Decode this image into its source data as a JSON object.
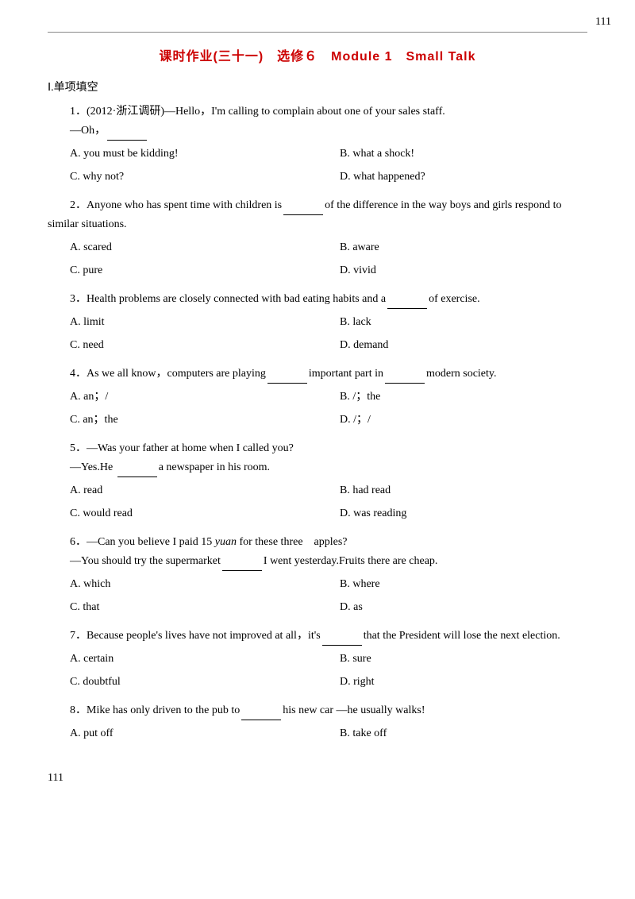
{
  "page": {
    "page_number_top": "111",
    "page_number_bottom": "111",
    "title": "课时作业(三十一)　选修６　Module 1　Small Talk",
    "section": "Ⅰ.单项填空",
    "questions": [
      {
        "id": "1",
        "source": "(2012·浙江调研)",
        "text": "—Hello，I'm calling to complain about one of your sales staff.",
        "continuation": "—Oh，________",
        "options": [
          {
            "letter": "A",
            "text": "you must be kidding!"
          },
          {
            "letter": "B",
            "text": "what a shock!"
          },
          {
            "letter": "C",
            "text": "why not?"
          },
          {
            "letter": "D",
            "text": "what happened?"
          }
        ]
      },
      {
        "id": "2",
        "text": "Anyone who has spent time with children is______of the difference in the way boys and girls respond to similar situations.",
        "options": [
          {
            "letter": "A",
            "text": "scared"
          },
          {
            "letter": "B",
            "text": "aware"
          },
          {
            "letter": "C",
            "text": "pure"
          },
          {
            "letter": "D",
            "text": "vivid"
          }
        ]
      },
      {
        "id": "3",
        "text": "Health  problems  are  closely  connected  with  bad  eating  habits  and a______of exercise.",
        "options": [
          {
            "letter": "A",
            "text": "limit"
          },
          {
            "letter": "B",
            "text": "lack"
          },
          {
            "letter": "C",
            "text": "need"
          },
          {
            "letter": "D",
            "text": "demand"
          }
        ]
      },
      {
        "id": "4",
        "text": "As  we  all  know，computers  are  playing________important  part  in________modern society.",
        "options": [
          {
            "letter": "A",
            "text": "an；/"
          },
          {
            "letter": "B",
            "text": "/；the"
          },
          {
            "letter": "C",
            "text": "an；the"
          },
          {
            "letter": "D",
            "text": "/；/"
          }
        ]
      },
      {
        "id": "5",
        "text": "—Was your father at home when I called you?",
        "continuation": "—Yes.He ________a newspaper in his room.",
        "options": [
          {
            "letter": "A",
            "text": "read"
          },
          {
            "letter": "B",
            "text": "had read"
          },
          {
            "letter": "C",
            "text": "would read"
          },
          {
            "letter": "D",
            "text": "was reading"
          }
        ]
      },
      {
        "id": "6",
        "text": "—Can you believe I paid 15 yuan for these three　apples?",
        "continuation": "—You should try the supermarket________I went yesterday.Fruits there are cheap.",
        "options": [
          {
            "letter": "A",
            "text": "which"
          },
          {
            "letter": "B",
            "text": "where"
          },
          {
            "letter": "C",
            "text": "that"
          },
          {
            "letter": "D",
            "text": "as"
          }
        ]
      },
      {
        "id": "7",
        "text": "Because people's lives have not improved at all，it's________that the President will lose the next election.",
        "options": [
          {
            "letter": "A",
            "text": "certain"
          },
          {
            "letter": "B",
            "text": "sure"
          },
          {
            "letter": "C",
            "text": "doubtful"
          },
          {
            "letter": "D",
            "text": "right"
          }
        ]
      },
      {
        "id": "8",
        "text": "Mike has only driven to the pub to________his new car —he usually walks!",
        "options": [
          {
            "letter": "A",
            "text": "put off"
          },
          {
            "letter": "B",
            "text": "take off"
          }
        ]
      }
    ]
  }
}
